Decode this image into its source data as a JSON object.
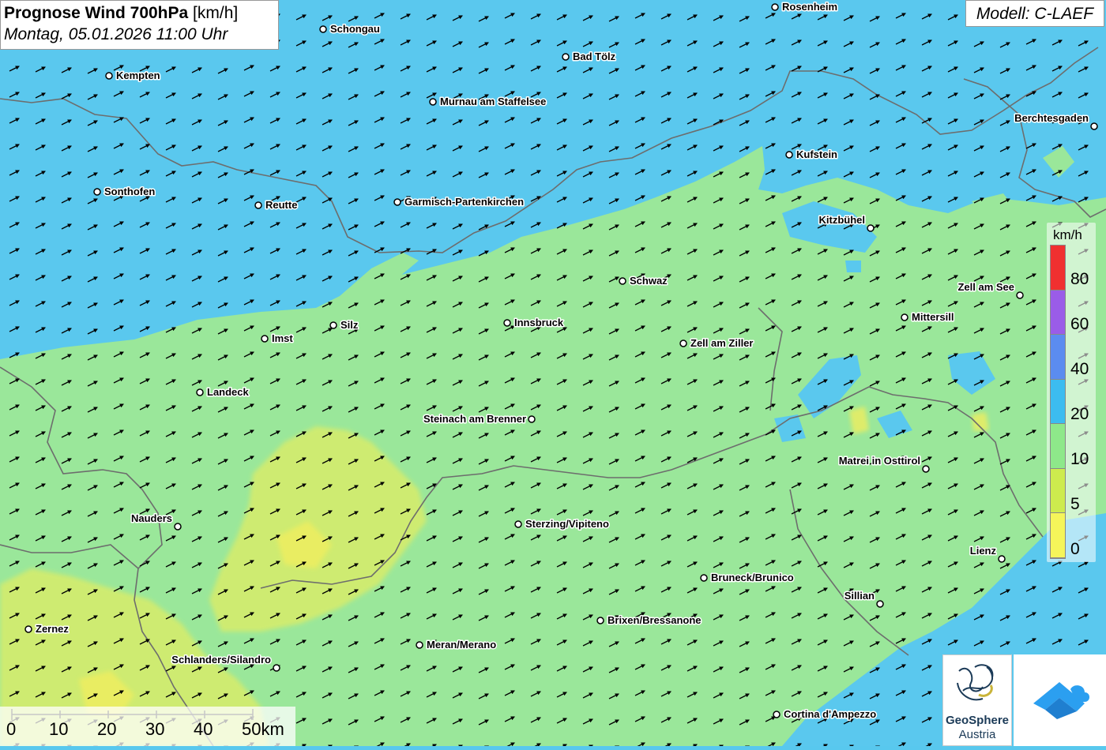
{
  "title": {
    "main": "Prognose Wind 700hPa",
    "unit": "[km/h]",
    "datetime": "Montag, 05.01.2026 11:00 Uhr"
  },
  "model": "Modell: C-LAEF",
  "legend": {
    "unit": "km/h",
    "ticks": [
      "80",
      "60",
      "40",
      "20",
      "10",
      "5",
      "0"
    ],
    "colors": [
      "#f03030",
      "#9a5ce8",
      "#5b8cf0",
      "#3cbcf0",
      "#8ee88a",
      "#cdeb4e",
      "#f5f55a"
    ]
  },
  "colors": {
    "sea_blue": "#58c8ee",
    "green": "#9ae79a",
    "yellow": "#e9ec6a",
    "border": "#666666"
  },
  "cities": [
    {
      "name": "Rosenheim"
    },
    {
      "name": "Schongau"
    },
    {
      "name": "Bad Tölz"
    },
    {
      "name": "Kempten"
    },
    {
      "name": "Murnau am Staffelsee"
    },
    {
      "name": "Berchtesgaden"
    },
    {
      "name": "Kufstein"
    },
    {
      "name": "Sonthofen"
    },
    {
      "name": "Reutte"
    },
    {
      "name": "Garmisch-Partenkirchen"
    },
    {
      "name": "Kitzbühel"
    },
    {
      "name": "Schwaz"
    },
    {
      "name": "Zell am See"
    },
    {
      "name": "Mittersill"
    },
    {
      "name": "Silz"
    },
    {
      "name": "Innsbruck"
    },
    {
      "name": "Imst"
    },
    {
      "name": "Zell am Ziller"
    },
    {
      "name": "Landeck"
    },
    {
      "name": "Steinach am Brenner"
    },
    {
      "name": "Matrei in Osttirol"
    },
    {
      "name": "Nauders"
    },
    {
      "name": "Sterzing/Vipiteno"
    },
    {
      "name": "Lienz"
    },
    {
      "name": "Bruneck/Brunico"
    },
    {
      "name": "Sillian"
    },
    {
      "name": "Brixen/Bressanone"
    },
    {
      "name": "Zernez"
    },
    {
      "name": "Meran/Merano"
    },
    {
      "name": "Schlanders/Silandro"
    },
    {
      "name": "Cortina d'Ampezzo"
    }
  ],
  "scalebar": {
    "labels": [
      "0",
      "10",
      "20",
      "30",
      "40",
      "50km"
    ]
  },
  "logo": {
    "name": "GeoSphere",
    "sub": "Austria"
  }
}
